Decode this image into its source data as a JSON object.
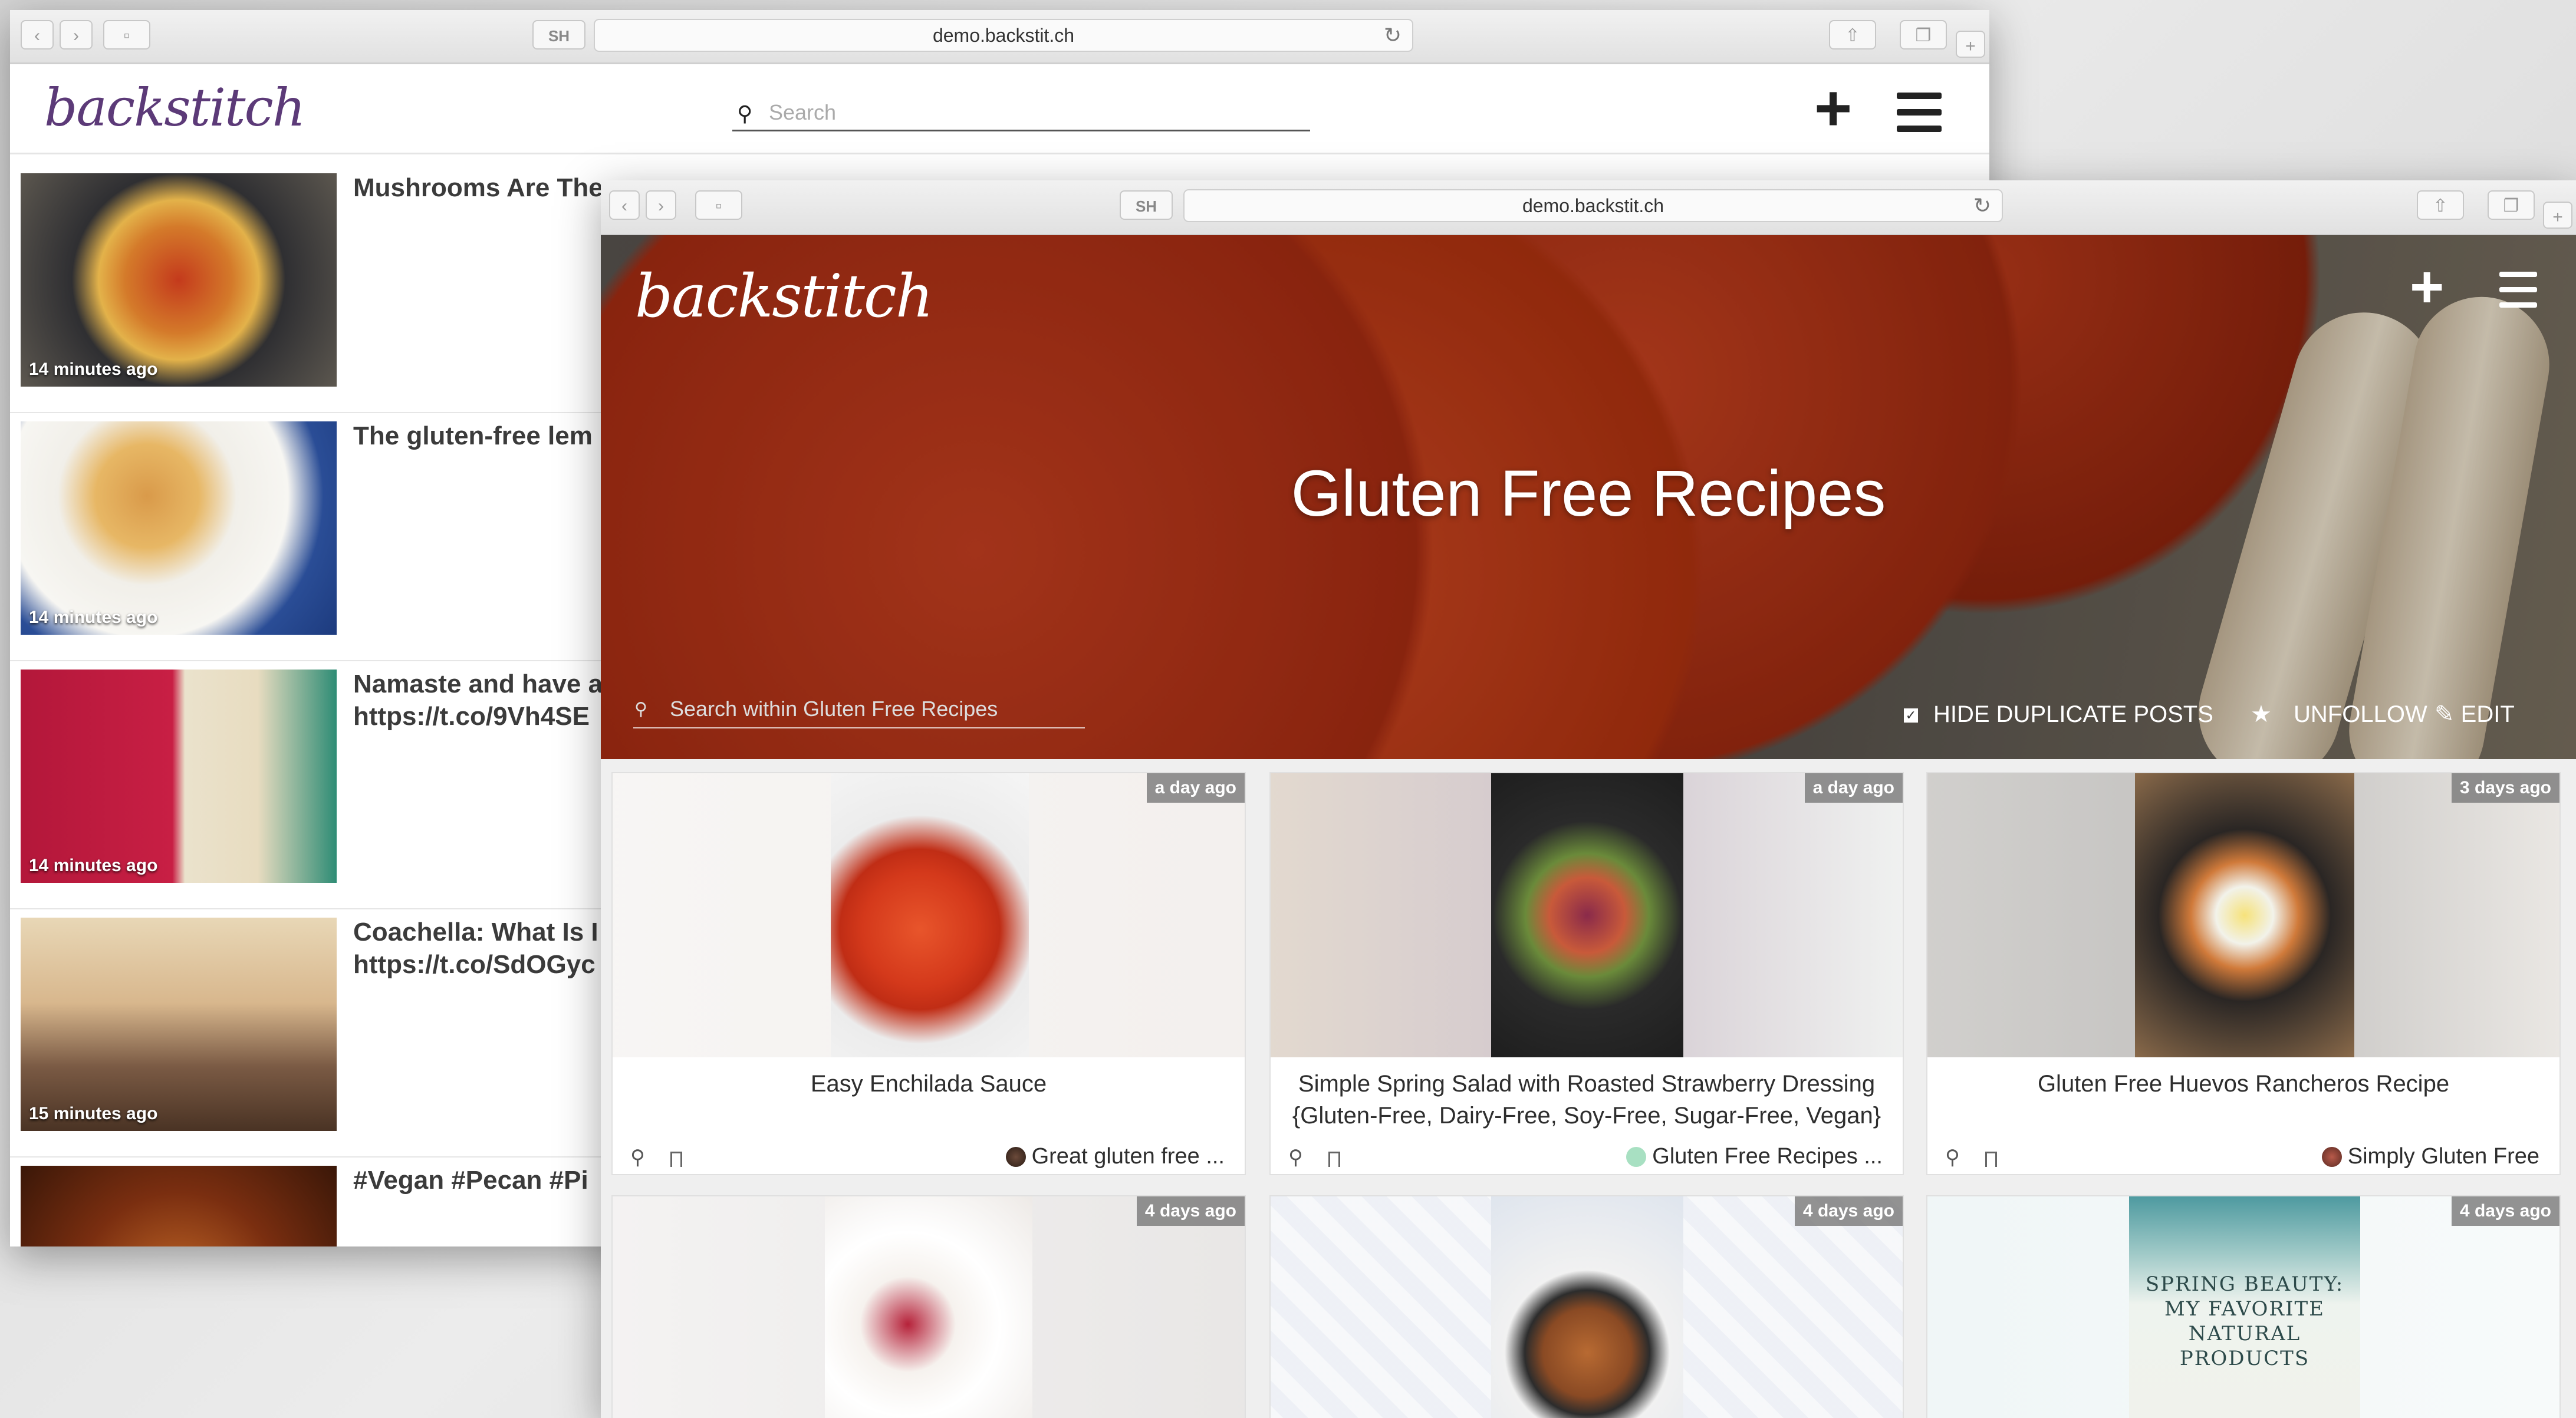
{
  "back_window": {
    "url": "demo.backstit.ch",
    "sh_label": "SH",
    "logo": "backstitch",
    "search_placeholder": "Search",
    "feed": [
      {
        "title": "Mushrooms Are The",
        "stamp": "14 minutes ago"
      },
      {
        "title": "The gluten-free lem",
        "stamp": "14 minutes ago"
      },
      {
        "title": "Namaste and have a\nhttps://t.co/9Vh4SE",
        "stamp": "14 minutes ago"
      },
      {
        "title": "Coachella: What Is I\nhttps://t.co/SdOGyc",
        "stamp": "15 minutes ago"
      },
      {
        "title": "#Vegan #Pecan #Pi",
        "stamp": ""
      }
    ]
  },
  "front_window": {
    "url": "demo.backstit.ch",
    "sh_label": "SH",
    "logo": "backstitch",
    "hero_title": "Gluten Free Recipes",
    "search_placeholder": "Search within Gluten Free Recipes",
    "hide_duplicates_label": "HIDE DUPLICATE POSTS",
    "unfollow_label": "UNFOLLOW",
    "edit_label": "EDIT",
    "cards": [
      {
        "time": "a day ago",
        "title": "Easy Enchilada Sauce",
        "source": "Great gluten free ..."
      },
      {
        "time": "a day ago",
        "title": "Simple Spring Salad with Roasted Strawberry Dressing {Gluten-Free, Dairy-Free, Soy-Free, Sugar-Free, Vegan}",
        "source": "Gluten Free Recipes ..."
      },
      {
        "time": "3 days ago",
        "title": "Gluten Free Huevos Rancheros Recipe",
        "source": "Simply Gluten Free"
      },
      {
        "time": "4 days ago",
        "title": "",
        "source": ""
      },
      {
        "time": "4 days ago",
        "title": "",
        "source": ""
      },
      {
        "time": "4 days ago",
        "title": "",
        "source": "",
        "image_text": "SPRING BEAUTY:\nMY FAVORITE\nNATURAL\nPRODUCTS"
      }
    ]
  },
  "colors": {
    "brand_purple": "#5c3a78",
    "badge_bg": "#7a7a7a"
  }
}
